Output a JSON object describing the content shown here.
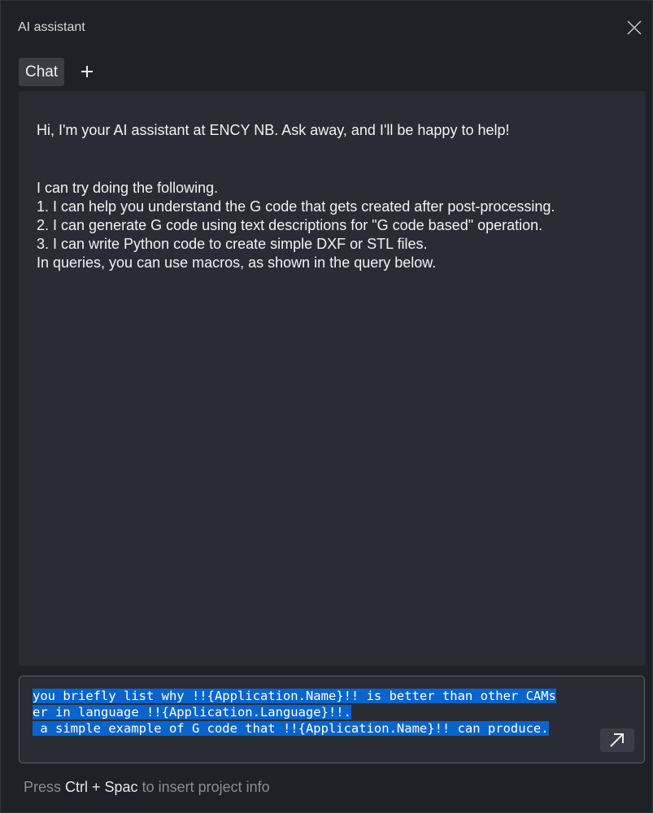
{
  "window": {
    "title": "AI assistant"
  },
  "tabs": [
    {
      "label": "Chat",
      "active": true
    }
  ],
  "add_tab_icon": "plus-icon",
  "close_icon": "close-icon",
  "messages": {
    "greeting": "Hi, I'm your AI assistant at ENCY NB. Ask away, and I'll be happy to help!",
    "capabilities": [
      "I can try doing the following.",
      "1. I can help you understand the G code that gets created after post-processing.",
      "2. I can generate G code using text descriptions for \"G code based\" operation.",
      "3. I can write Python code to create simple DXF or STL files.",
      "In queries, you can use macros, as shown in the query below."
    ]
  },
  "input": {
    "lines": [
      "you briefly list why !!{Application.Name}!! is better than other CAMs",
      "er in language !!{Application.Language}!!.",
      " a simple example of G code that !!{Application.Name}!! can produce."
    ],
    "selected": true,
    "send_icon": "arrow-up-right-icon"
  },
  "hint": {
    "prefix": "Press ",
    "shortcut": "Ctrl + Spac",
    "suffix": " to insert project info"
  },
  "colors": {
    "background": "#1f2128",
    "panel": "#292c35",
    "selection": "#0a64cc",
    "hint_text": "#8a8d95"
  }
}
